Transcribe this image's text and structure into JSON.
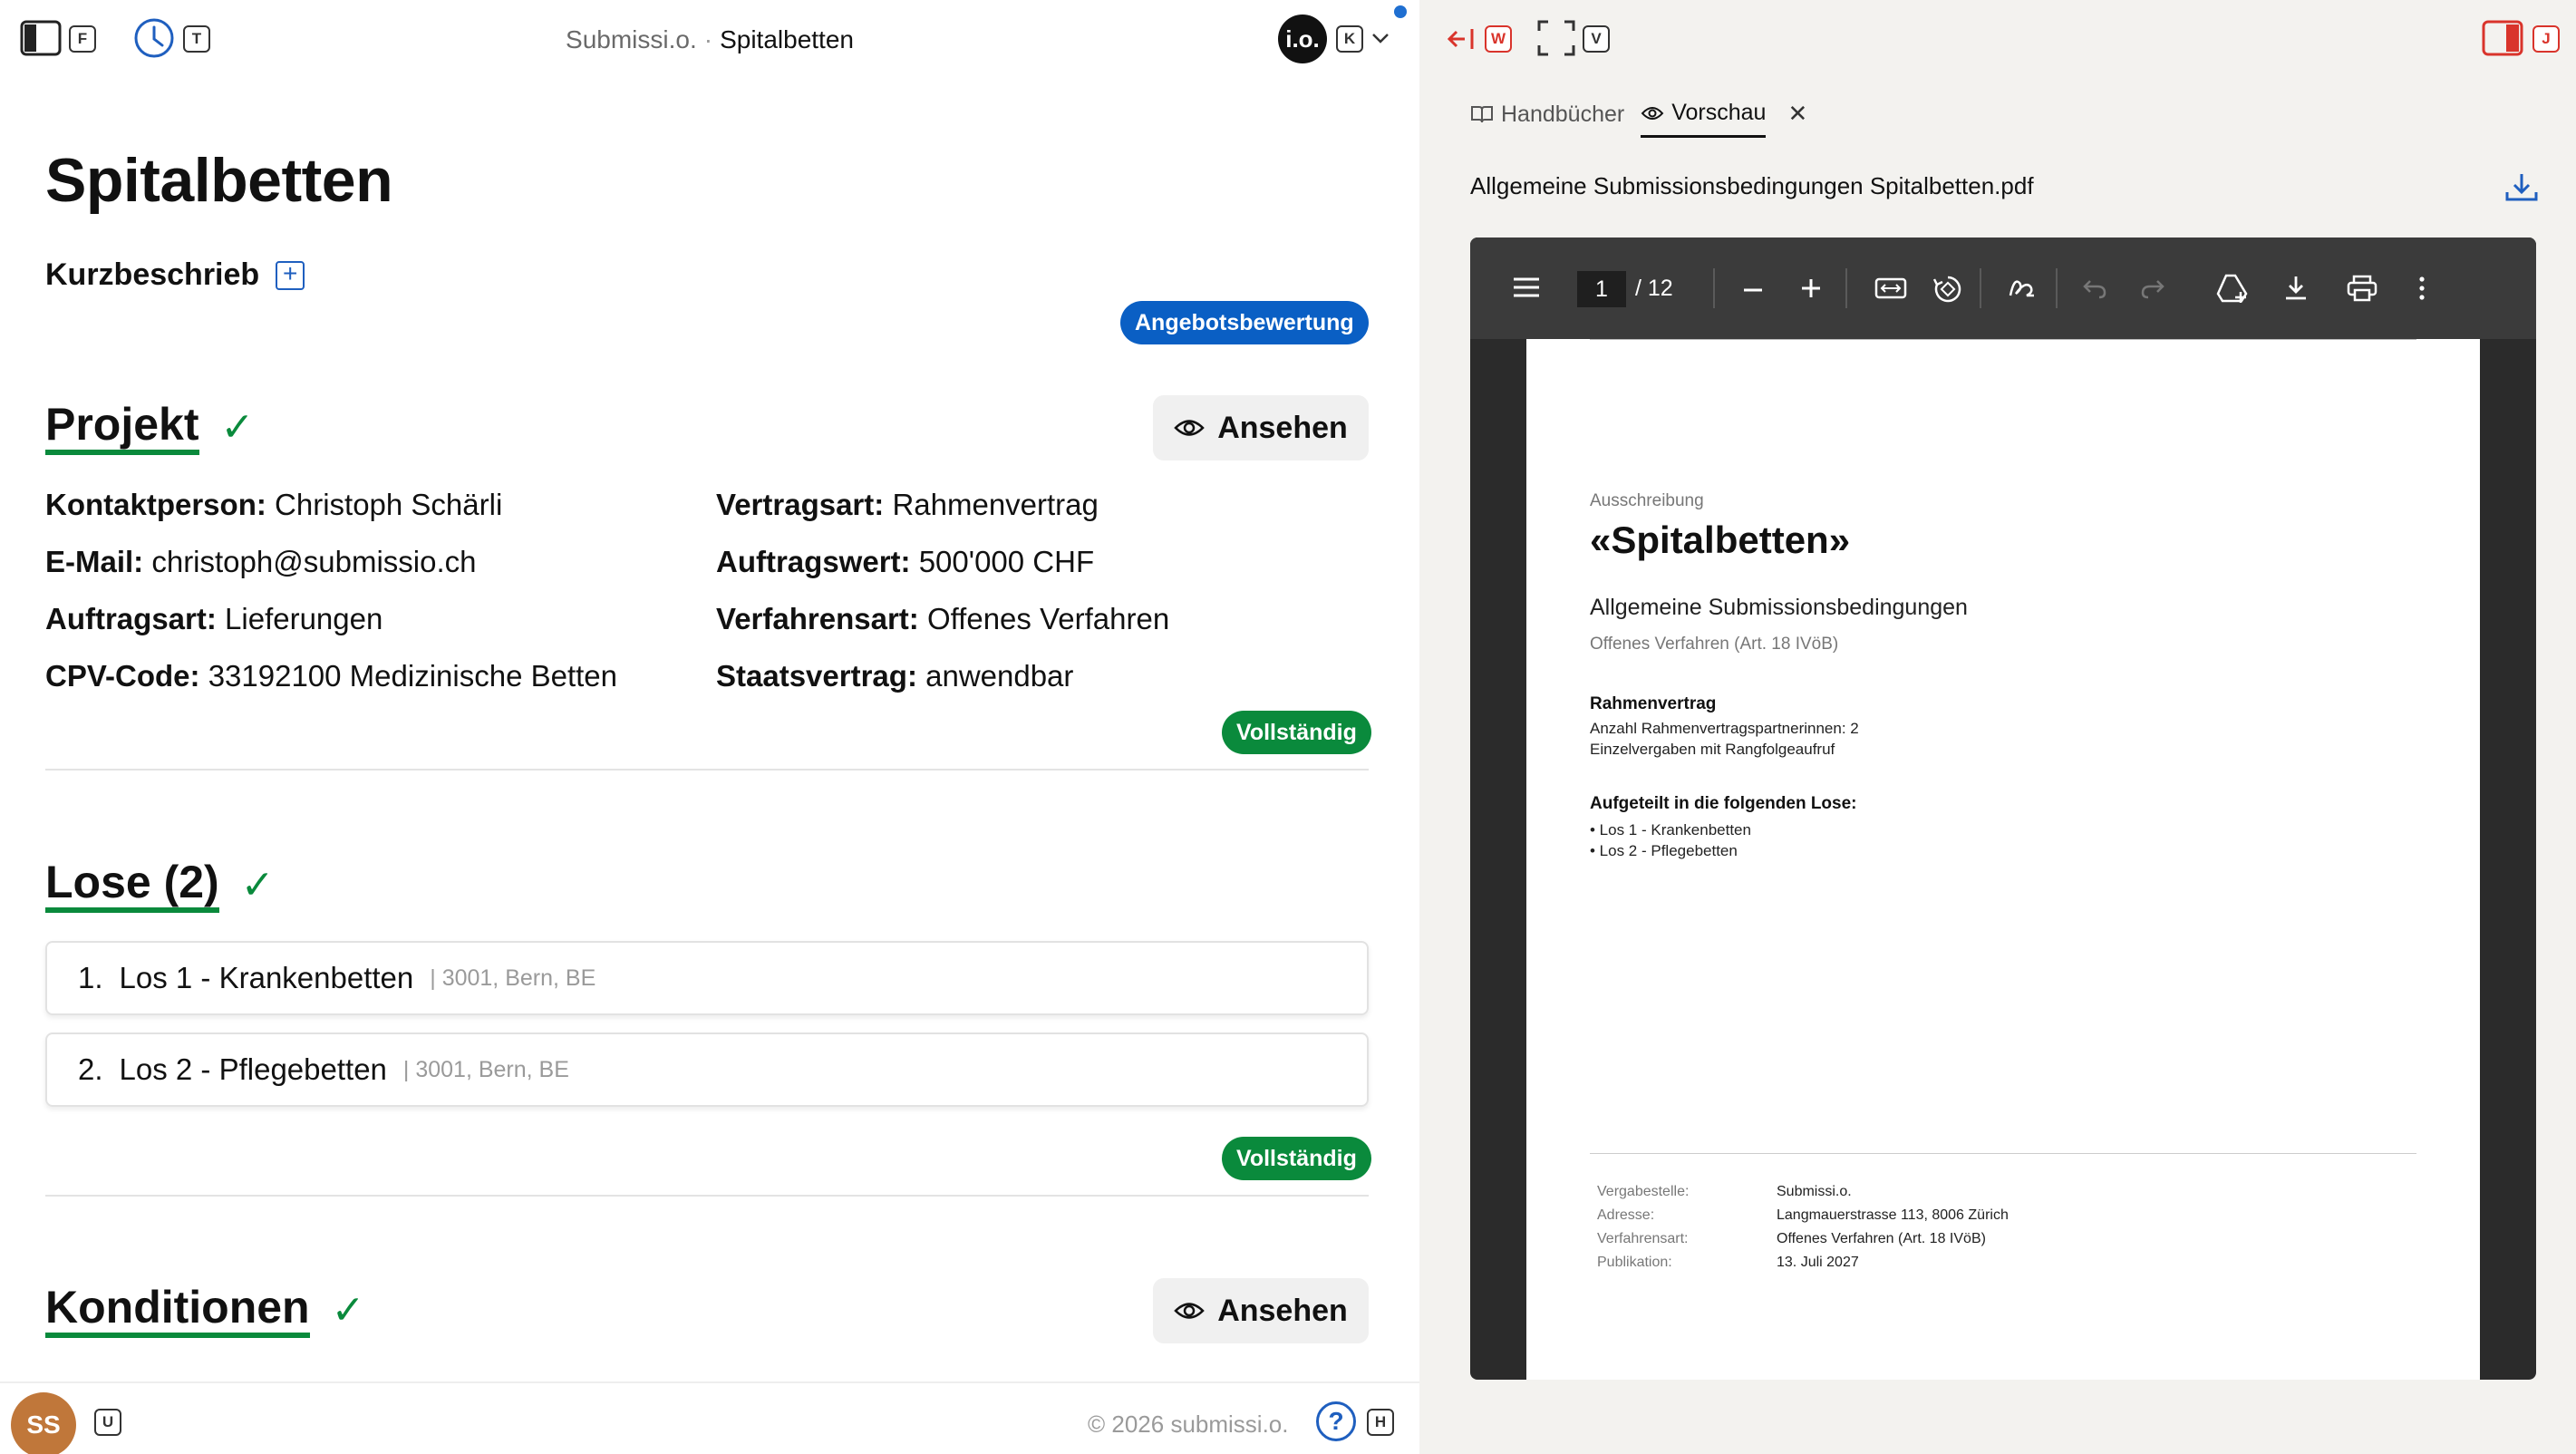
{
  "left": {
    "topbar": {
      "sidebar_key": "F",
      "history_key": "T",
      "app_name": "Submissi.o.",
      "separator": "·",
      "current_page": "Spitalbetten",
      "account_initials": "i.o.",
      "account_key": "K"
    },
    "page_title": "Spitalbetten",
    "kurzbeschrieb_label": "Kurzbeschrieb",
    "angebotsbewertung_badge": "Angebotsbewertung",
    "projekt": {
      "heading": "Projekt",
      "view_button": "Ansehen",
      "fields_left": [
        {
          "label": "Kontaktperson:",
          "value": "Christoph Schärli"
        },
        {
          "label": "E-Mail:",
          "value": "christoph@submissio.ch"
        },
        {
          "label": "Auftragsart:",
          "value": "Lieferungen"
        },
        {
          "label": "CPV-Code:",
          "value": "33192100 Medizinische Betten"
        }
      ],
      "fields_right": [
        {
          "label": "Vertragsart:",
          "value": "Rahmenvertrag"
        },
        {
          "label": "Auftragswert:",
          "value": "500'000 CHF"
        },
        {
          "label": "Verfahrensart:",
          "value": "Offenes Verfahren"
        },
        {
          "label": "Staatsvertrag:",
          "value": "anwendbar"
        }
      ],
      "status": "Vollständig"
    },
    "lose": {
      "heading": "Lose (2)",
      "items": [
        {
          "num": "1.",
          "name": "Los 1 - Krankenbetten",
          "meta": "| 3001, Bern, BE"
        },
        {
          "num": "2.",
          "name": "Los 2 - Pflegebetten",
          "meta": "| 3001, Bern, BE"
        }
      ],
      "status": "Vollständig"
    },
    "konditionen": {
      "heading": "Konditionen",
      "view_button": "Ansehen"
    },
    "footer": {
      "user_initials": "SS",
      "user_key": "U",
      "copyright": "© 2026 submissi.o.",
      "help_symbol": "?",
      "help_key": "H"
    }
  },
  "right": {
    "topbar": {
      "close_key": "W",
      "expand_key": "V",
      "panel_key": "J"
    },
    "tabs": [
      {
        "label": "Handbücher",
        "icon": "book-icon"
      },
      {
        "label": "Vorschau",
        "icon": "eye-icon"
      }
    ],
    "pdf_filename": "Allgemeine Submissionsbedingungen Spitalbetten.pdf",
    "viewer": {
      "current_page": "1",
      "page_count": "/ 12"
    },
    "document": {
      "label": "Ausschreibung",
      "title": "«Spitalbetten»",
      "subtitle": "Allgemeine Submissionsbedingungen",
      "procedure": "Offenes Verfahren (Art. 18 IVöB)",
      "contract_heading": "Rahmenvertrag",
      "contract_lines": [
        "Anzahl Rahmenvertragspartnerinnen: 2",
        "Einzelvergaben mit Rangfolgeaufruf"
      ],
      "lots_heading": "Aufgeteilt in die folgenden Lose:",
      "lots": [
        "•  Los 1 - Krankenbetten",
        "•  Los 2 - Pflegebetten"
      ],
      "footer_rows": [
        {
          "key": "Vergabestelle:",
          "value": "Submissi.o."
        },
        {
          "key": "Adresse:",
          "value": "Langmauerstrasse 113, 8006 Zürich"
        },
        {
          "key": "Verfahrensart:",
          "value": "Offenes Verfahren (Art. 18 IVöB)"
        },
        {
          "key": "Publikation:",
          "value": "13. Juli 2027"
        }
      ]
    }
  },
  "colors": {
    "accent_blue": "#0a5fc4",
    "success_green": "#0a8a3c",
    "close_red": "#d9342b",
    "avatar_orange": "#c0773a"
  }
}
